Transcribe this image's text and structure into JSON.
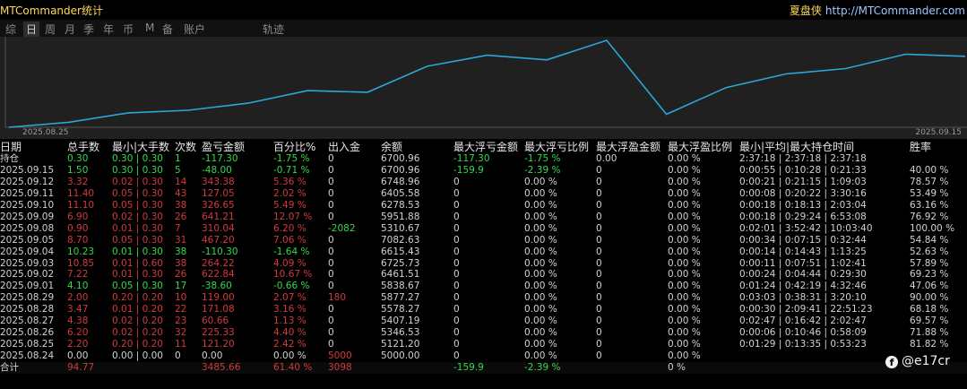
{
  "window": {
    "title": "MTCommander统计"
  },
  "brand": {
    "name": "夏盘侠",
    "url": "http://MTCommander.com"
  },
  "tabs": [
    "综",
    "日",
    "周",
    "月",
    "季",
    "年",
    "币",
    "M",
    "备",
    "账户",
    "轨迹"
  ],
  "active_tab": "日",
  "chart": {
    "date_start": "2025.08.25",
    "date_end": "2025.09.15",
    "line_color": "#2aa7d8",
    "balance_points": [
      5000.0,
      5121.2,
      5346.53,
      5407.19,
      5578.27,
      5877.27,
      5838.67,
      6461.51,
      6725.73,
      6615.43,
      7082.63,
      5310.67,
      5951.88,
      6278.53,
      6405.58,
      6748.98,
      6700.96
    ]
  },
  "columns": [
    "日期",
    "总手数",
    "最小|大手数",
    "次数",
    "盈亏金额",
    "百分比%",
    "出入金",
    "余额",
    "最大浮亏金额",
    "最大浮亏比例",
    "最大浮盈金额",
    "最大浮盈比例",
    "最小|平均|最大持仓时间",
    "胜率"
  ],
  "rows": [
    {
      "date": "持仓",
      "lots": "0.30",
      "minmax": "0.30 | 0.30",
      "count": "1",
      "pnl": "-117.30",
      "pct": "-1.75 %",
      "flow": "0",
      "balance": "6700.96",
      "max_dd": "-117.30",
      "max_dd_pct": "-1.75 %",
      "max_gain": "0.00",
      "max_gain_pct": "0.00 %",
      "hold": "2:37:18 | 2:37:18 | 2:37:18",
      "win": "",
      "color": "green"
    },
    {
      "date": "2025.09.15",
      "lots": "1.50",
      "minmax": "0.30 | 0.30",
      "count": "5",
      "pnl": "-48.00",
      "pct": "-0.71 %",
      "flow": "0",
      "balance": "6700.96",
      "max_dd": "-159.9",
      "max_dd_pct": "-2.39 %",
      "max_gain": "0",
      "max_gain_pct": "0.00 %",
      "hold": "0:00:55 | 0:10:28 | 0:21:33",
      "win": "40.00 %",
      "color": "green"
    },
    {
      "date": "2025.09.12",
      "lots": "3.32",
      "minmax": "0.02 | 0.30",
      "count": "14",
      "pnl": "343.38",
      "pct": "5.36 %",
      "flow": "0",
      "balance": "6748.96",
      "max_dd": "0",
      "max_dd_pct": "0.00 %",
      "max_gain": "0",
      "max_gain_pct": "0.00 %",
      "hold": "0:00:21 | 0:21:15 | 1:09:03",
      "win": "78.57 %",
      "color": "red"
    },
    {
      "date": "2025.09.11",
      "lots": "11.40",
      "minmax": "0.05 | 0.30",
      "count": "43",
      "pnl": "127.05",
      "pct": "2.02 %",
      "flow": "0",
      "balance": "6405.58",
      "max_dd": "0",
      "max_dd_pct": "0.00 %",
      "max_gain": "0",
      "max_gain_pct": "0.00 %",
      "hold": "0:00:08 | 0:20:22 | 3:30:16",
      "win": "53.49 %",
      "color": "red"
    },
    {
      "date": "2025.09.10",
      "lots": "11.10",
      "minmax": "0.05 | 0.30",
      "count": "38",
      "pnl": "326.65",
      "pct": "5.49 %",
      "flow": "0",
      "balance": "6278.53",
      "max_dd": "0",
      "max_dd_pct": "0.00 %",
      "max_gain": "0",
      "max_gain_pct": "0.00 %",
      "hold": "0:00:18 | 0:18:13 | 2:03:04",
      "win": "63.16 %",
      "color": "red"
    },
    {
      "date": "2025.09.09",
      "lots": "6.90",
      "minmax": "0.02 | 0.30",
      "count": "26",
      "pnl": "641.21",
      "pct": "12.07 %",
      "flow": "0",
      "balance": "5951.88",
      "max_dd": "0",
      "max_dd_pct": "0.00 %",
      "max_gain": "0",
      "max_gain_pct": "0.00 %",
      "hold": "0:00:18 | 0:29:24 | 6:53:08",
      "win": "76.92 %",
      "color": "red"
    },
    {
      "date": "2025.09.08",
      "lots": "0.90",
      "minmax": "0.01 | 0.30",
      "count": "7",
      "pnl": "310.04",
      "pct": "6.20 %",
      "flow": "-2082",
      "balance": "5310.67",
      "max_dd": "0",
      "max_dd_pct": "0.00 %",
      "max_gain": "0",
      "max_gain_pct": "0.00 %",
      "hold": "0:02:01 | 3:52:42 | 10:03:40",
      "win": "100.00 %",
      "color": "red",
      "flow_color": "green"
    },
    {
      "date": "2025.09.05",
      "lots": "8.70",
      "minmax": "0.05 | 0.30",
      "count": "31",
      "pnl": "467.20",
      "pct": "7.06 %",
      "flow": "0",
      "balance": "7082.63",
      "max_dd": "0",
      "max_dd_pct": "0.00 %",
      "max_gain": "0",
      "max_gain_pct": "0.00 %",
      "hold": "0:00:34 | 0:07:15 | 0:32:44",
      "win": "54.84 %",
      "color": "red"
    },
    {
      "date": "2025.09.04",
      "lots": "10.23",
      "minmax": "0.01 | 0.30",
      "count": "38",
      "pnl": "-110.30",
      "pct": "-1.64 %",
      "flow": "0",
      "balance": "6615.43",
      "max_dd": "0",
      "max_dd_pct": "0.00 %",
      "max_gain": "0",
      "max_gain_pct": "0.00 %",
      "hold": "0:00:14 | 0:14:43 | 1:13:25",
      "win": "52.63 %",
      "color": "green"
    },
    {
      "date": "2025.09.03",
      "lots": "10.85",
      "minmax": "0.01 | 0.60",
      "count": "38",
      "pnl": "264.22",
      "pct": "4.09 %",
      "flow": "0",
      "balance": "6725.73",
      "max_dd": "0",
      "max_dd_pct": "0.00 %",
      "max_gain": "0",
      "max_gain_pct": "0.00 %",
      "hold": "0:00:11 | 0:07:51 | 1:02:41",
      "win": "57.89 %",
      "color": "red"
    },
    {
      "date": "2025.09.02",
      "lots": "7.22",
      "minmax": "0.01 | 0.30",
      "count": "26",
      "pnl": "622.84",
      "pct": "10.67 %",
      "flow": "0",
      "balance": "6461.51",
      "max_dd": "0",
      "max_dd_pct": "0.00 %",
      "max_gain": "0",
      "max_gain_pct": "0.00 %",
      "hold": "0:00:24 | 0:04:44 | 0:29:30",
      "win": "69.23 %",
      "color": "red"
    },
    {
      "date": "2025.09.01",
      "lots": "4.10",
      "minmax": "0.05 | 0.30",
      "count": "17",
      "pnl": "-38.60",
      "pct": "-0.66 %",
      "flow": "0",
      "balance": "5838.67",
      "max_dd": "0",
      "max_dd_pct": "0.00 %",
      "max_gain": "0",
      "max_gain_pct": "0.00 %",
      "hold": "0:01:24 | 0:42:19 | 4:32:46",
      "win": "47.06 %",
      "color": "green"
    },
    {
      "date": "2025.08.29",
      "lots": "2.00",
      "minmax": "0.20 | 0.20",
      "count": "10",
      "pnl": "119.00",
      "pct": "2.07 %",
      "flow": "180",
      "balance": "5877.27",
      "max_dd": "0",
      "max_dd_pct": "0.00 %",
      "max_gain": "0",
      "max_gain_pct": "0.00 %",
      "hold": "0:03:03 | 0:38:31 | 3:20:10",
      "win": "90.00 %",
      "color": "red",
      "flow_color": "red"
    },
    {
      "date": "2025.08.28",
      "lots": "3.47",
      "minmax": "0.01 | 0.20",
      "count": "22",
      "pnl": "171.08",
      "pct": "3.16 %",
      "flow": "0",
      "balance": "5578.27",
      "max_dd": "0",
      "max_dd_pct": "0.00 %",
      "max_gain": "0",
      "max_gain_pct": "0.00 %",
      "hold": "0:00:30 | 2:09:41 | 22:51:23",
      "win": "68.18 %",
      "color": "red"
    },
    {
      "date": "2025.08.27",
      "lots": "4.38",
      "minmax": "0.02 | 0.20",
      "count": "23",
      "pnl": "60.66",
      "pct": "1.13 %",
      "flow": "0",
      "balance": "5407.19",
      "max_dd": "0",
      "max_dd_pct": "0.00 %",
      "max_gain": "0",
      "max_gain_pct": "0.00 %",
      "hold": "0:02:47 | 0:16:42 | 2:02:47",
      "win": "69.57 %",
      "color": "red"
    },
    {
      "date": "2025.08.26",
      "lots": "6.20",
      "minmax": "0.02 | 0.20",
      "count": "32",
      "pnl": "225.33",
      "pct": "4.40 %",
      "flow": "0",
      "balance": "5346.53",
      "max_dd": "0",
      "max_dd_pct": "0.00 %",
      "max_gain": "0",
      "max_gain_pct": "0.00 %",
      "hold": "0:00:06 | 0:10:46 | 0:58:09",
      "win": "71.88 %",
      "color": "red"
    },
    {
      "date": "2025.08.25",
      "lots": "2.20",
      "minmax": "0.20 | 0.20",
      "count": "11",
      "pnl": "121.20",
      "pct": "2.42 %",
      "flow": "0",
      "balance": "5121.20",
      "max_dd": "0",
      "max_dd_pct": "0.00 %",
      "max_gain": "0",
      "max_gain_pct": "0.00 %",
      "hold": "0:01:29 | 0:13:35 | 0:53:23",
      "win": "81.82 %",
      "color": "red"
    },
    {
      "date": "2025.08.24",
      "lots": "0.00",
      "minmax": "0.00 | 0.00",
      "count": "0",
      "pnl": "0.00",
      "pct": "0.00 %",
      "flow": "5000",
      "balance": "5000.00",
      "max_dd": "0",
      "max_dd_pct": "0.00 %",
      "max_gain": "0",
      "max_gain_pct": "0.00 %",
      "hold": "",
      "win": "",
      "color": "white",
      "flow_color": "red"
    }
  ],
  "total": {
    "date": "合计",
    "lots": "94.77",
    "pnl": "3485.66",
    "pct": "61.40 %",
    "flow": "3098",
    "max_dd": "-159.9",
    "max_dd_pct": "-2.39 %",
    "max_gain_pct": "0 %"
  },
  "watermark": "@e17cr"
}
